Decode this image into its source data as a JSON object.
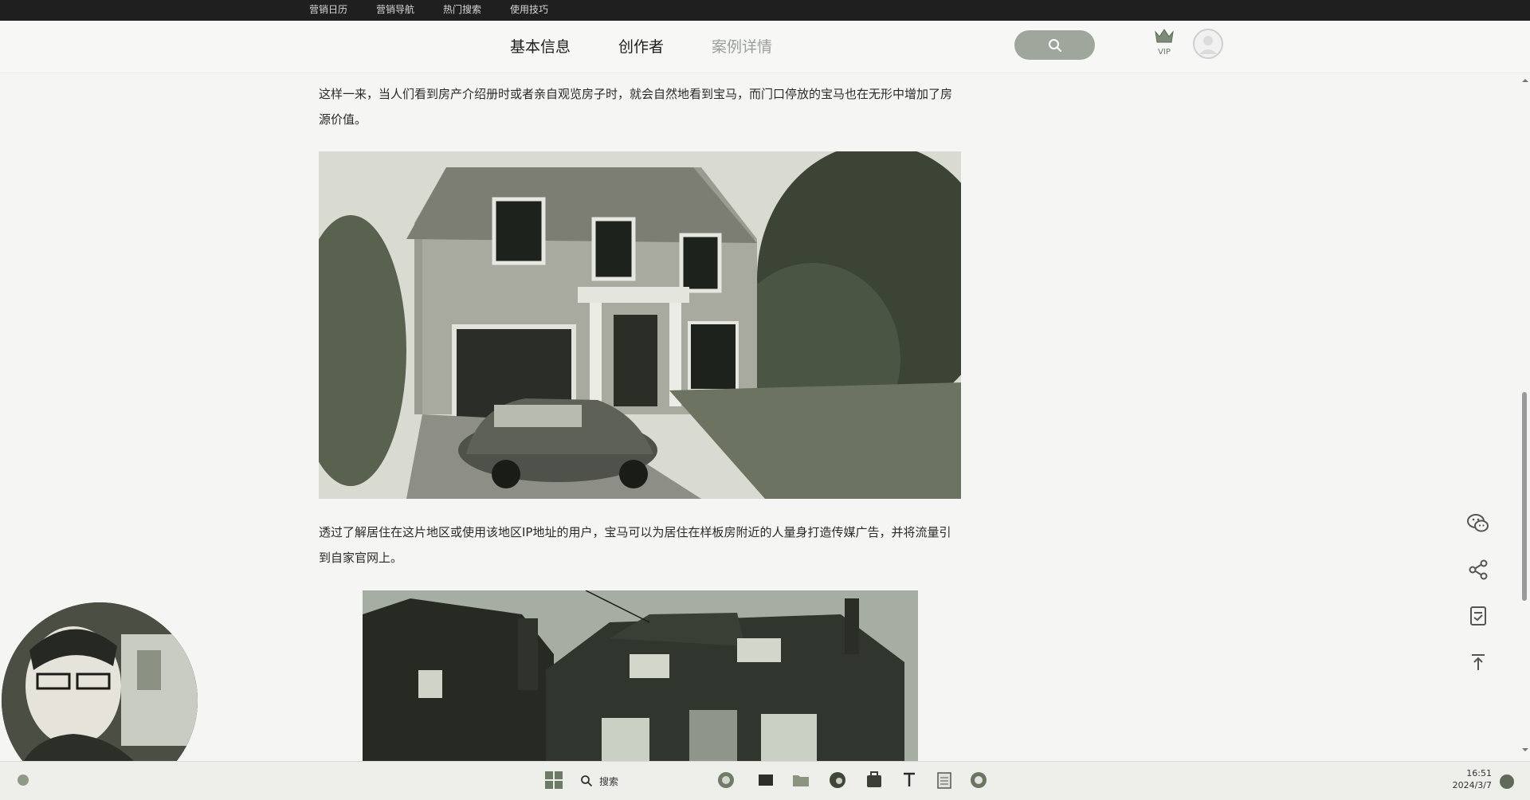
{
  "topbar": {
    "links": [
      "营销日历",
      "营销导航",
      "热门搜索",
      "使用技巧"
    ]
  },
  "header": {
    "tabs": [
      "基本信息",
      "创作者",
      "案例详情"
    ],
    "vip_label": "VIP"
  },
  "article": {
    "para1": "这样一来，当人们看到房产介绍册时或者亲自观览房子时，就会自然地看到宝马，而门口停放的宝马也在无形中增加了房源价值。",
    "para2": "透过了解居住在这片地区或使用该地区IP地址的用户，宝马可以为居住在样板房附近的人量身打造传媒广告，并将流量引到自家官网上。"
  },
  "side_icons": [
    "wechat-icon",
    "share-icon",
    "note-icon",
    "back-to-top-icon"
  ],
  "taskbar": {
    "search_label": "搜索",
    "time": "16:51",
    "date": "2024/3/7"
  },
  "colors": {
    "topbar": "#1f1f1f",
    "search_button": "#9fa79c",
    "page_bg": "#f5f5f3",
    "tab_dim": "#9aa09a"
  }
}
